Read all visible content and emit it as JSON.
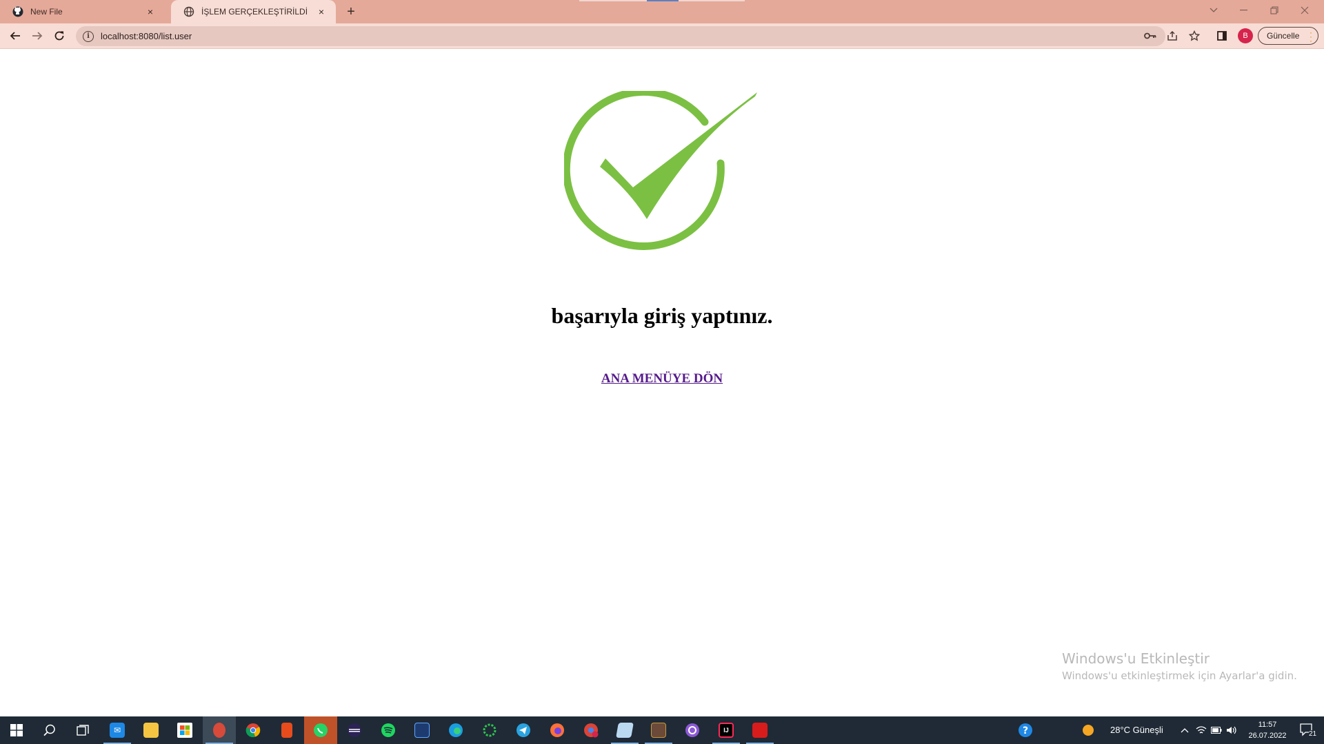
{
  "browser": {
    "tabs": [
      {
        "title": "New File",
        "favicon": "github-icon",
        "active": false
      },
      {
        "title": "İŞLEM GERÇEKLEŞTİRİLDİ",
        "favicon": "globe-icon",
        "active": true
      }
    ],
    "new_tab_label": "+",
    "close_glyph": "×",
    "address": "localhost:8080/list.user",
    "update_label": "Güncelle",
    "profile_initial": "B",
    "colors": {
      "tabstrip": "#e5a999",
      "toolbar": "#f7ddd6",
      "omnibox": "#e6c8c1"
    }
  },
  "page": {
    "heading": "başarıyla giriş yaptınız.",
    "link": "ANA MENÜYE DÖN",
    "check_color": "#7bc043"
  },
  "watermark": {
    "title": "Windows'u Etkinleştir",
    "subtitle": "Windows'u etkinleştirmek için Ayarlar'a gidin."
  },
  "taskbar": {
    "apps": [
      "start-icon",
      "search-icon",
      "task-view-icon",
      "mail-icon",
      "file-explorer-icon",
      "store-icon",
      "app-pinned-icon",
      "chrome-icon",
      "office-icon",
      "whatsapp-icon",
      "eclipse-icon",
      "spotify-icon",
      "vscode-icon",
      "edge-icon",
      "app-ring-icon",
      "telegram-icon",
      "firefox-icon",
      "chrome-profile-icon",
      "notepad-icon",
      "game-icon",
      "github-desktop-icon",
      "intellij-icon",
      "acrobat-icon"
    ],
    "weather": "28°C  Güneşli",
    "time": "11:57",
    "date": "26.07.2022",
    "notification_count": "21"
  }
}
